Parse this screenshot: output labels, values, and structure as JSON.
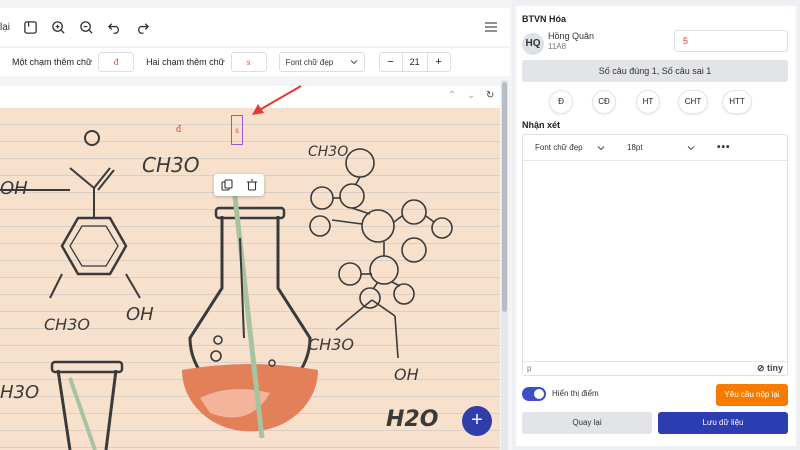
{
  "toolbar": {
    "back_label": "lại"
  },
  "options": {
    "one_tap_label": "Một chạm thêm chữ",
    "one_tap_char": "đ",
    "two_tap_label": "Hai chạm thêm chữ",
    "two_tap_char": "s",
    "font_select": "Font chữ đẹp",
    "font_size": "21",
    "minus": "−",
    "plus": "+"
  },
  "canvas": {
    "mark_d": "đ",
    "selected_char": "s",
    "fab_label": "+",
    "labels": [
      "CH3O",
      "CH3O",
      "CH3O",
      "OH",
      "H3O",
      "OH",
      "CH3O",
      "OH",
      "H2O"
    ]
  },
  "panel": {
    "title": "BTVN Hóa",
    "avatar_initials": "HQ",
    "student_name": "Hồng Quân",
    "student_class": "11A8",
    "score": "5",
    "summary": "Số câu đúng 1, Số câu sai 1",
    "tags": [
      "Đ",
      "CĐ",
      "HT",
      "CHT",
      "HTT"
    ],
    "comment_label": "Nhận xét",
    "editor_font": "Font chữ đẹp",
    "editor_size": "18pt",
    "editor_more": "•••",
    "editor_path": "p",
    "editor_brand": "tiny",
    "toggle_label": "Hiển thị điểm",
    "request_button": "Yêu cầu nộp lại",
    "back_button": "Quay lại",
    "save_button": "Lưu dữ liệu"
  },
  "colors": {
    "accent": "#2b3db0",
    "warning": "#f57c00",
    "mark_red": "#e53935",
    "selection": "#9b59d0",
    "paper": "#f7e1cc"
  }
}
